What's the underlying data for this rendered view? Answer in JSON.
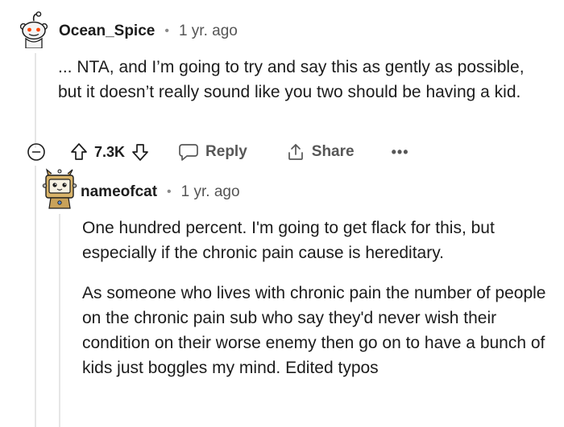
{
  "parent_comment": {
    "username": "Ocean_Spice",
    "separator": "•",
    "time": "1 yr. ago",
    "body": "... NTA, and I’m going to try and say this as gently as possible, but it doesn’t really sound like you two should be having a kid.",
    "actions": {
      "vote_count": "7.3K",
      "reply_label": "Reply",
      "share_label": "Share",
      "more_label": "•••"
    }
  },
  "reply_comment": {
    "username": "nameofcat",
    "separator": "•",
    "time": "1 yr. ago",
    "paragraphs": [
      "One hundred percent. I'm going to get flack for this, but especially if the chronic pain cause is hereditary.",
      "As someone who lives with chronic pain the number of people on the chronic pain sub who say they'd never wish their condition on their worse enemy then go on to have a bunch of kids just boggles my mind. Edited typos"
    ]
  },
  "icons": {
    "collapse": "minus-circle-icon",
    "upvote": "arrow-up-outline-icon",
    "downvote": "arrow-down-outline-icon",
    "reply": "speech-bubble-icon",
    "share": "share-upload-icon",
    "more": "ellipsis-icon"
  },
  "colors": {
    "text_primary": "#1c1c1c",
    "text_secondary": "#555555",
    "action_gray": "#575757",
    "thread_line": "#e6e6e6"
  }
}
